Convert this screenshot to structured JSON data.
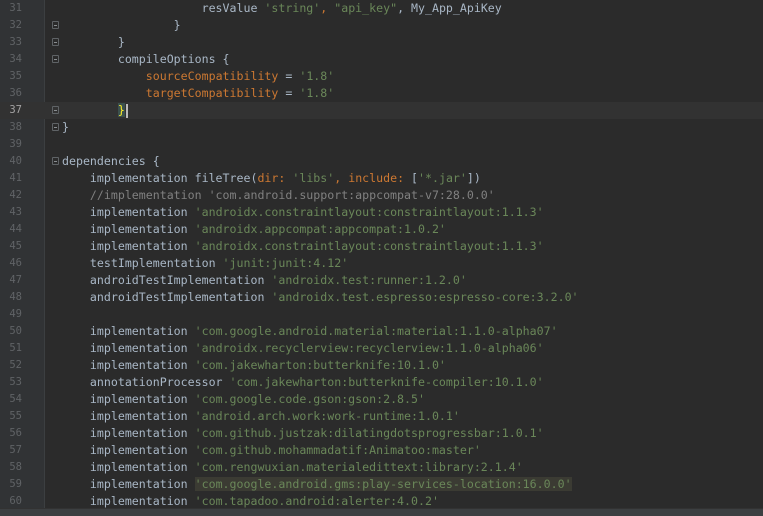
{
  "editor": {
    "lines": [
      {
        "num": "31",
        "tokens": [
          {
            "t": "                    resValue ",
            "c": "p"
          },
          {
            "t": "'string'",
            "c": "s"
          },
          {
            "t": ", ",
            "c": "k"
          },
          {
            "t": "\"api_key\"",
            "c": "s"
          },
          {
            "t": ", My_App_ApiKey",
            "c": "p"
          }
        ]
      },
      {
        "num": "32",
        "fold": true,
        "tokens": [
          {
            "t": "                }",
            "c": "p"
          }
        ]
      },
      {
        "num": "33",
        "fold": true,
        "tokens": [
          {
            "t": "        }",
            "c": "p"
          }
        ]
      },
      {
        "num": "34",
        "fold": true,
        "tokens": [
          {
            "t": "        compileOptions ",
            "c": "p"
          },
          {
            "t": "{",
            "c": "p"
          }
        ]
      },
      {
        "num": "35",
        "tokens": [
          {
            "t": "            ",
            "c": "p"
          },
          {
            "t": "sourceCompatibility",
            "c": "k"
          },
          {
            "t": " = ",
            "c": "p"
          },
          {
            "t": "'1.8'",
            "c": "s"
          }
        ]
      },
      {
        "num": "36",
        "tokens": [
          {
            "t": "            ",
            "c": "p"
          },
          {
            "t": "targetCompatibility",
            "c": "k"
          },
          {
            "t": " = ",
            "c": "p"
          },
          {
            "t": "'1.8'",
            "c": "s"
          }
        ]
      },
      {
        "num": "37",
        "fold": true,
        "current": true,
        "tokens": [
          {
            "t": "        ",
            "c": "p"
          },
          {
            "t": "}",
            "c": "brace-hl"
          },
          {
            "t": "",
            "c": "caret"
          }
        ]
      },
      {
        "num": "38",
        "fold": true,
        "tokens": [
          {
            "t": "}",
            "c": "p"
          }
        ]
      },
      {
        "num": "39",
        "tokens": []
      },
      {
        "num": "40",
        "fold": true,
        "tokens": [
          {
            "t": "dependencies ",
            "c": "p"
          },
          {
            "t": "{",
            "c": "p"
          }
        ]
      },
      {
        "num": "41",
        "tokens": [
          {
            "t": "    implementation fileTree(",
            "c": "p"
          },
          {
            "t": "dir: ",
            "c": "k"
          },
          {
            "t": "'libs'",
            "c": "s"
          },
          {
            "t": ", ",
            "c": "k"
          },
          {
            "t": "include: ",
            "c": "k"
          },
          {
            "t": "[",
            "c": "p"
          },
          {
            "t": "'*.jar'",
            "c": "s"
          },
          {
            "t": "])",
            "c": "p"
          }
        ]
      },
      {
        "num": "42",
        "tokens": [
          {
            "t": "    //implementation 'com.android.support:appcompat-v7:28.0.0'",
            "c": "c"
          }
        ]
      },
      {
        "num": "43",
        "tokens": [
          {
            "t": "    implementation ",
            "c": "p"
          },
          {
            "t": "'androidx.constraintlayout:constraintlayout:1.1.3'",
            "c": "s"
          }
        ]
      },
      {
        "num": "44",
        "tokens": [
          {
            "t": "    implementation ",
            "c": "p"
          },
          {
            "t": "'androidx.appcompat:appcompat:1.0.2'",
            "c": "s"
          }
        ]
      },
      {
        "num": "45",
        "tokens": [
          {
            "t": "    implementation ",
            "c": "p"
          },
          {
            "t": "'androidx.constraintlayout:constraintlayout:1.1.3'",
            "c": "s"
          }
        ]
      },
      {
        "num": "46",
        "tokens": [
          {
            "t": "    testImplementation ",
            "c": "p"
          },
          {
            "t": "'junit:junit:4.12'",
            "c": "s"
          }
        ]
      },
      {
        "num": "47",
        "tokens": [
          {
            "t": "    androidTestImplementation ",
            "c": "p"
          },
          {
            "t": "'androidx.test:runner:1.2.0'",
            "c": "s"
          }
        ]
      },
      {
        "num": "48",
        "tokens": [
          {
            "t": "    androidTestImplementation ",
            "c": "p"
          },
          {
            "t": "'androidx.test.espresso:espresso-core:3.2.0'",
            "c": "s"
          }
        ]
      },
      {
        "num": "49",
        "tokens": []
      },
      {
        "num": "50",
        "tokens": [
          {
            "t": "    implementation ",
            "c": "p"
          },
          {
            "t": "'com.google.android.material:material:1.1.0-alpha07'",
            "c": "s"
          }
        ]
      },
      {
        "num": "51",
        "tokens": [
          {
            "t": "    implementation ",
            "c": "p"
          },
          {
            "t": "'androidx.recyclerview:recyclerview:1.1.0-alpha06'",
            "c": "s"
          }
        ]
      },
      {
        "num": "52",
        "tokens": [
          {
            "t": "    implementation ",
            "c": "p"
          },
          {
            "t": "'com.jakewharton:butterknife:10.1.0'",
            "c": "s"
          }
        ]
      },
      {
        "num": "53",
        "tokens": [
          {
            "t": "    annotationProcessor ",
            "c": "p"
          },
          {
            "t": "'com.jakewharton:butterknife-compiler:10.1.0'",
            "c": "s"
          }
        ]
      },
      {
        "num": "54",
        "tokens": [
          {
            "t": "    implementation ",
            "c": "p"
          },
          {
            "t": "'com.google.code.gson:gson:2.8.5'",
            "c": "s"
          }
        ]
      },
      {
        "num": "55",
        "tokens": [
          {
            "t": "    implementation ",
            "c": "p"
          },
          {
            "t": "'android.arch.work:work-runtime:1.0.1'",
            "c": "s"
          }
        ]
      },
      {
        "num": "56",
        "tokens": [
          {
            "t": "    implementation ",
            "c": "p"
          },
          {
            "t": "'com.github.justzak:dilatingdotsprogressbar:1.0.1'",
            "c": "s"
          }
        ]
      },
      {
        "num": "57",
        "tokens": [
          {
            "t": "    implementation ",
            "c": "p"
          },
          {
            "t": "'com.github.mohammadatif:Animatoo:master'",
            "c": "s"
          }
        ]
      },
      {
        "num": "58",
        "tokens": [
          {
            "t": "    implementation ",
            "c": "p"
          },
          {
            "t": "'com.rengwuxian.materialedittext:library:2.1.4'",
            "c": "s"
          }
        ]
      },
      {
        "num": "59",
        "tokens": [
          {
            "t": "    implementation ",
            "c": "p"
          },
          {
            "t": "'com.google.android.gms:play-services-location:16.0.0'",
            "c": "s hl"
          }
        ]
      },
      {
        "num": "60",
        "tokens": [
          {
            "t": "    implementation ",
            "c": "p"
          },
          {
            "t": "'com.tapadoo.android:alerter:4.0.2'",
            "c": "s"
          }
        ]
      }
    ]
  }
}
